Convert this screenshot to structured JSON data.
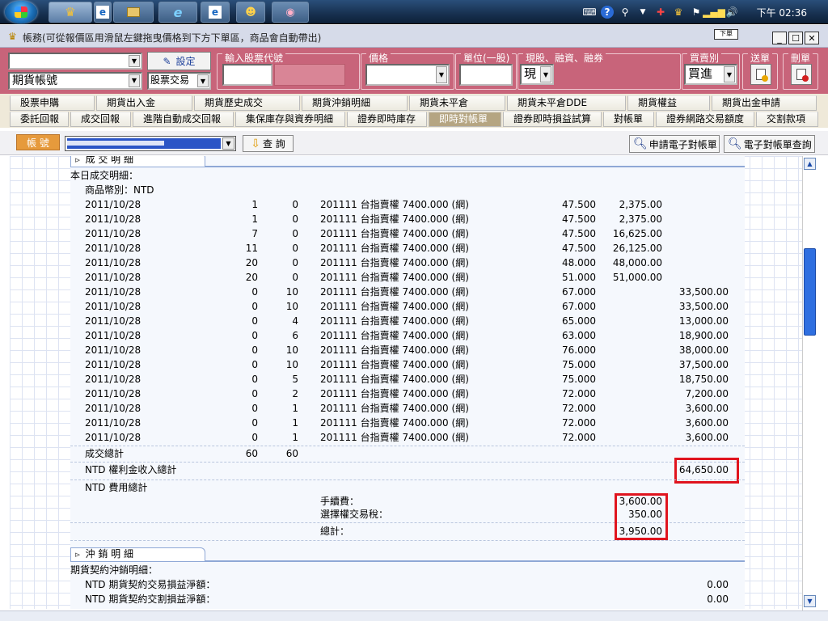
{
  "taskbar": {
    "clock": "下午 02:36",
    "tray_icons": [
      "keyboard-icon",
      "help-icon",
      "usb-icon",
      "dropdown-icon",
      "network-app-icon",
      "crown-icon",
      "flag-icon",
      "signal-icon",
      "volume-icon"
    ]
  },
  "window": {
    "title": "帳務(可從報價區用滑鼠左鍵拖曳價格到下方下單區，商品會自動帶出)",
    "mini_label": "下單"
  },
  "toolbar": {
    "account_placeholder": "期貨帳號",
    "set_label": "設定",
    "trade_type": "股票交易",
    "group_stock_code": "輸入股票代號",
    "group_price": "價格",
    "group_unit": "單位(一股)",
    "group_cash": "現股、融資、融券",
    "cash_value": "現",
    "group_side": "買賣別",
    "side_value": "買進",
    "group_send": "送單",
    "group_delete": "刪單"
  },
  "tabs": {
    "row1": [
      "股票申購",
      "期貨出入金",
      "期貨歷史成交",
      "期貨沖銷明細",
      "期貨未平倉",
      "期貨未平倉DDE",
      "期貨權益",
      "期貨出金申請"
    ],
    "row2": [
      "委託回報",
      "成交回報",
      "進階自動成交回報",
      "集保庫存與資券明細",
      "證券即時庫存",
      "即時對帳單",
      "證券即時損益試算",
      "對帳單",
      "證券網路交易額度",
      "交割款項"
    ],
    "selected": "即時對帳單"
  },
  "acctbar": {
    "label": "帳 號",
    "query": "查 詢",
    "apply_statement": "申請電子對帳單",
    "query_statement": "電子對帳單查詢"
  },
  "content": {
    "sec_trades": "成 交 明 細",
    "today_trades": "本日成交明細：",
    "currency": "商品幣別：NTD",
    "rows": [
      {
        "date": "2011/10/28",
        "buy": "1",
        "sell": "0",
        "product": "201111 台指賣權 7400.000 (網)",
        "price": "47.500",
        "pay": "2,375.00",
        "recv": ""
      },
      {
        "date": "2011/10/28",
        "buy": "1",
        "sell": "0",
        "product": "201111 台指賣權 7400.000 (網)",
        "price": "47.500",
        "pay": "2,375.00",
        "recv": ""
      },
      {
        "date": "2011/10/28",
        "buy": "7",
        "sell": "0",
        "product": "201111 台指賣權 7400.000 (網)",
        "price": "47.500",
        "pay": "16,625.00",
        "recv": ""
      },
      {
        "date": "2011/10/28",
        "buy": "11",
        "sell": "0",
        "product": "201111 台指賣權 7400.000 (網)",
        "price": "47.500",
        "pay": "26,125.00",
        "recv": ""
      },
      {
        "date": "2011/10/28",
        "buy": "20",
        "sell": "0",
        "product": "201111 台指賣權 7400.000 (網)",
        "price": "48.000",
        "pay": "48,000.00",
        "recv": ""
      },
      {
        "date": "2011/10/28",
        "buy": "20",
        "sell": "0",
        "product": "201111 台指賣權 7400.000 (網)",
        "price": "51.000",
        "pay": "51,000.00",
        "recv": ""
      },
      {
        "date": "2011/10/28",
        "buy": "0",
        "sell": "10",
        "product": "201111 台指賣權 7400.000 (網)",
        "price": "67.000",
        "pay": "",
        "recv": "33,500.00"
      },
      {
        "date": "2011/10/28",
        "buy": "0",
        "sell": "10",
        "product": "201111 台指賣權 7400.000 (網)",
        "price": "67.000",
        "pay": "",
        "recv": "33,500.00"
      },
      {
        "date": "2011/10/28",
        "buy": "0",
        "sell": "4",
        "product": "201111 台指賣權 7400.000 (網)",
        "price": "65.000",
        "pay": "",
        "recv": "13,000.00"
      },
      {
        "date": "2011/10/28",
        "buy": "0",
        "sell": "6",
        "product": "201111 台指賣權 7400.000 (網)",
        "price": "63.000",
        "pay": "",
        "recv": "18,900.00"
      },
      {
        "date": "2011/10/28",
        "buy": "0",
        "sell": "10",
        "product": "201111 台指賣權 7400.000 (網)",
        "price": "76.000",
        "pay": "",
        "recv": "38,000.00"
      },
      {
        "date": "2011/10/28",
        "buy": "0",
        "sell": "10",
        "product": "201111 台指賣權 7400.000 (網)",
        "price": "75.000",
        "pay": "",
        "recv": "37,500.00"
      },
      {
        "date": "2011/10/28",
        "buy": "0",
        "sell": "5",
        "product": "201111 台指賣權 7400.000 (網)",
        "price": "75.000",
        "pay": "",
        "recv": "18,750.00"
      },
      {
        "date": "2011/10/28",
        "buy": "0",
        "sell": "2",
        "product": "201111 台指賣權 7400.000 (網)",
        "price": "72.000",
        "pay": "",
        "recv": "7,200.00"
      },
      {
        "date": "2011/10/28",
        "buy": "0",
        "sell": "1",
        "product": "201111 台指賣權 7400.000 (網)",
        "price": "72.000",
        "pay": "",
        "recv": "3,600.00"
      },
      {
        "date": "2011/10/28",
        "buy": "0",
        "sell": "1",
        "product": "201111 台指賣權 7400.000 (網)",
        "price": "72.000",
        "pay": "",
        "recv": "3,600.00"
      },
      {
        "date": "2011/10/28",
        "buy": "0",
        "sell": "1",
        "product": "201111 台指賣權 7400.000 (網)",
        "price": "72.000",
        "pay": "",
        "recv": "3,600.00"
      }
    ],
    "total_label": "成交總計",
    "total_buy": "60",
    "total_sell": "60",
    "premium_label": "NTD 權利金收入總計",
    "premium_value": "64,650.00",
    "fee_total_label": "NTD 費用總計",
    "fee_label": "手續費：",
    "fee_value": "3,600.00",
    "tax_label": "選擇權交易稅：",
    "tax_value": "350.00",
    "sum_label": "總計：",
    "sum_value": "3,950.00",
    "sec_offset": "沖 銷 明 細",
    "offset_title": "期貨契約沖銷明細：",
    "offset_pl_label": "NTD 期貨契約交易損益淨額：",
    "offset_pl_value": "0.00",
    "settle_pl_label": "NTD 期貨契約交割損益淨額：",
    "settle_pl_value": "0.00"
  }
}
